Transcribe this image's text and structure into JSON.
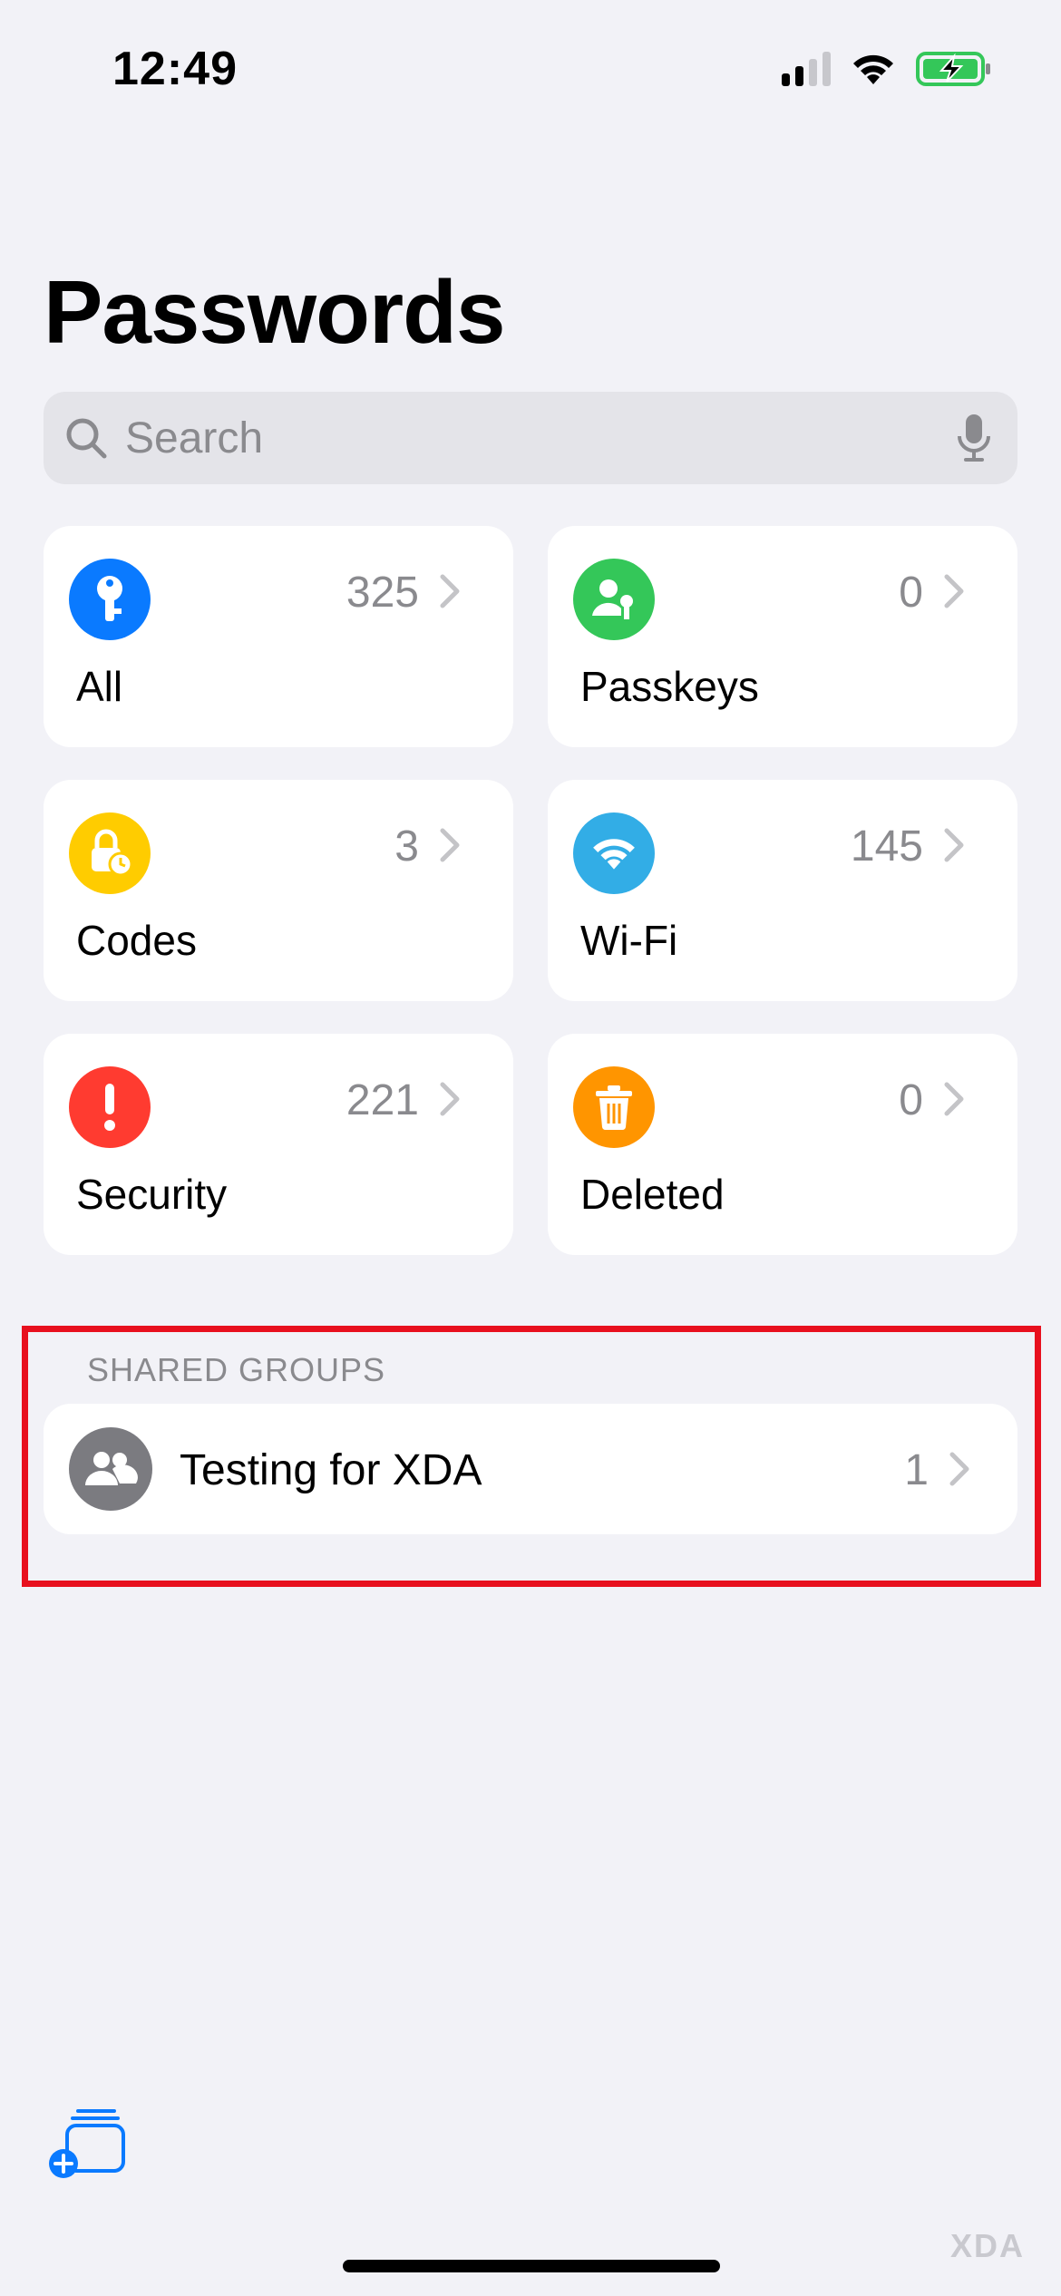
{
  "status_bar": {
    "time": "12:49"
  },
  "title": "Passwords",
  "search": {
    "placeholder": "Search"
  },
  "tiles": [
    {
      "label": "All",
      "count": "325",
      "icon": "key-icon",
      "color": "#0a7aff"
    },
    {
      "label": "Passkeys",
      "count": "0",
      "icon": "person-key-icon",
      "color": "#34c759"
    },
    {
      "label": "Codes",
      "count": "3",
      "icon": "lock-clock-icon",
      "color": "#ffcc00"
    },
    {
      "label": "Wi-Fi",
      "count": "145",
      "icon": "wifi-icon",
      "color": "#32ade6"
    },
    {
      "label": "Security",
      "count": "221",
      "icon": "exclamation-icon",
      "color": "#ff3b30"
    },
    {
      "label": "Deleted",
      "count": "0",
      "icon": "trash-icon",
      "color": "#ff9500"
    }
  ],
  "shared_groups": {
    "header": "SHARED GROUPS",
    "items": [
      {
        "name": "Testing for XDA",
        "count": "1",
        "icon": "people-icon"
      }
    ]
  },
  "watermark": "XDA"
}
